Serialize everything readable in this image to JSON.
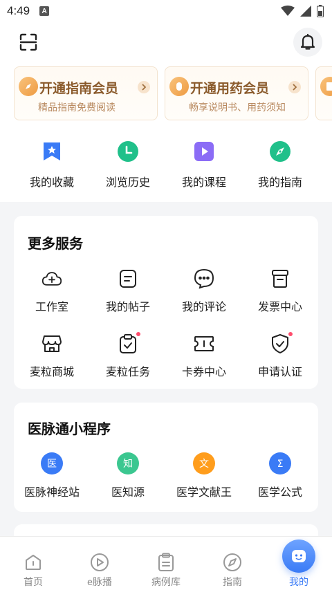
{
  "status_bar": {
    "time": "4:49",
    "notification_badge": "A"
  },
  "header": {
    "scan_icon": "scan-icon",
    "bell_icon": "bell-icon"
  },
  "vip_cards": [
    {
      "title": "开通指南会员",
      "subtitle": "精品指南免费阅读",
      "icon": "compass-icon"
    },
    {
      "title": "开通用药会员",
      "subtitle": "畅享说明书、用药须知",
      "icon": "pill-icon"
    }
  ],
  "quick_actions": [
    {
      "label": "我的收藏",
      "icon": "bookmark-star-icon",
      "color": "#3a7bf6"
    },
    {
      "label": "浏览历史",
      "icon": "clock-icon",
      "color": "#20c08a"
    },
    {
      "label": "我的课程",
      "icon": "play-icon",
      "color": "#8b6cf6"
    },
    {
      "label": "我的指南",
      "icon": "compass-icon",
      "color": "#20c08a"
    }
  ],
  "more_services": {
    "title": "更多服务",
    "items": [
      {
        "label": "工作室",
        "icon": "cloud-plus-icon",
        "dot": false
      },
      {
        "label": "我的帖子",
        "icon": "post-icon",
        "dot": false
      },
      {
        "label": "我的评论",
        "icon": "comment-icon",
        "dot": false
      },
      {
        "label": "发票中心",
        "icon": "invoice-icon",
        "dot": false
      },
      {
        "label": "麦粒商城",
        "icon": "shop-icon",
        "dot": false
      },
      {
        "label": "麦粒任务",
        "icon": "task-clipboard-icon",
        "dot": true
      },
      {
        "label": "卡券中心",
        "icon": "coupon-icon",
        "dot": false
      },
      {
        "label": "申请认证",
        "icon": "shield-check-icon",
        "dot": true
      }
    ]
  },
  "mini_programs": {
    "title": "医脉通小程序",
    "items": [
      {
        "label": "医脉神经站",
        "icon": "neuro-station-icon",
        "glyph": "医",
        "color": "#3a7bf6"
      },
      {
        "label": "医知源",
        "icon": "yizhiyuan-icon",
        "glyph": "知",
        "color": "#3bc790"
      },
      {
        "label": "医学文献王",
        "icon": "literature-king-icon",
        "glyph": "文",
        "color": "#ff9d1c"
      },
      {
        "label": "医学公式",
        "icon": "formula-icon",
        "glyph": "Σ",
        "color": "#3a7bf6"
      }
    ]
  },
  "tab_bar": {
    "active_color": "#3a7bf6",
    "tabs": [
      {
        "label": "首页",
        "icon": "home-icon",
        "active": false
      },
      {
        "label": "e脉播",
        "icon": "play-circle-icon",
        "active": false
      },
      {
        "label": "病例库",
        "icon": "clipboard-icon",
        "active": false
      },
      {
        "label": "指南",
        "icon": "compass-tab-icon",
        "active": false
      },
      {
        "label": "我的",
        "icon": "profile-face-icon",
        "active": true
      }
    ]
  }
}
